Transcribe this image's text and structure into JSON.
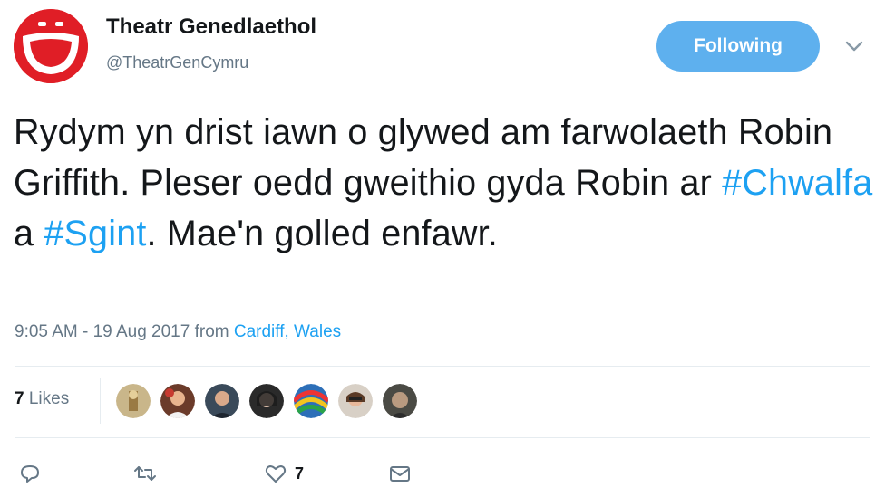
{
  "account": {
    "name": "Theatr Genedlaethol",
    "handle": "@TheatrGenCymru",
    "avatar_color": "#e01e26"
  },
  "follow_button": {
    "label": "Following",
    "color": "#5eb0ee"
  },
  "tweet": {
    "text_1": "Rydym yn drist iawn o glywed am farwolaeth Robin Griffith. Pleser oedd gweithio gyda Robin ar ",
    "hashtag_1": "#Chwalfa",
    "text_2": " a ",
    "hashtag_2": "#Sgint",
    "text_3": ". Mae'n golled enfawr.",
    "hashtag_color": "#1da1f2"
  },
  "meta": {
    "timestamp": "9:05 AM - 19 Aug 2017",
    "from_label": "from",
    "location": "Cardiff, Wales"
  },
  "likes": {
    "count": "7",
    "label": "Likes",
    "avatar_count": 7
  },
  "actions": {
    "reply_icon": "reply-icon",
    "retweet_icon": "retweet-icon",
    "like_icon": "heart-icon",
    "like_count": "7",
    "dm_icon": "envelope-icon"
  }
}
